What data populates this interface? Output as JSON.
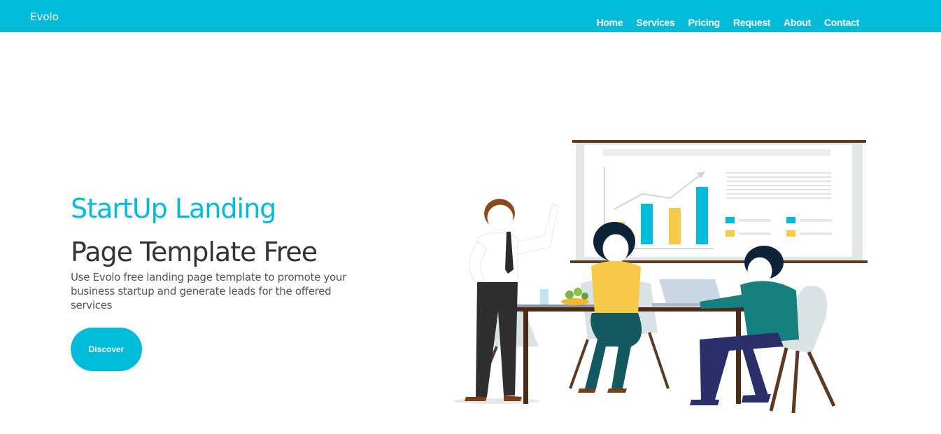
{
  "navbar": {
    "brand": "Evolo",
    "links": [
      "Home",
      "Services",
      "Pricing",
      "Request",
      "About",
      "Contact"
    ]
  },
  "hero": {
    "title_line1": "StartUp Landing",
    "title_line2": "Page Template Free",
    "description": "Use Evolo free landing page template to promote your business startup and generate leads for the offered services",
    "button_label": "Discover"
  },
  "colors": {
    "accent": "#00bcd9",
    "heading": "#333333",
    "text": "#555555",
    "chart_yellow": "#f7c948"
  }
}
